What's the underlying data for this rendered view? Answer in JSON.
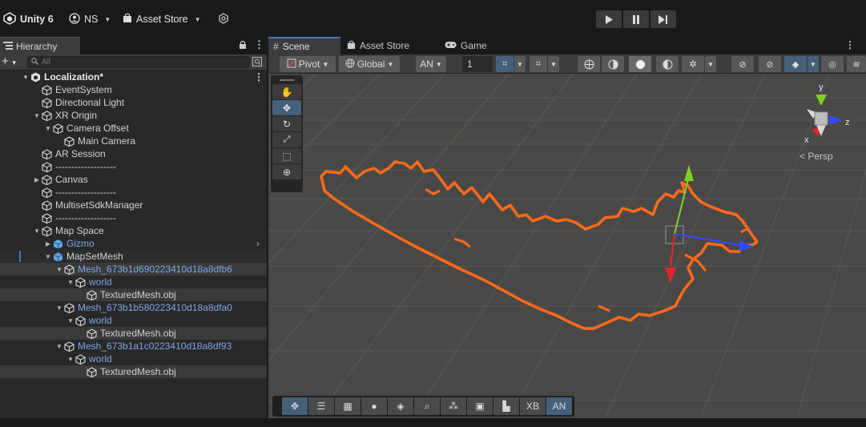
{
  "topbar": {
    "app_title": "Unity 6",
    "account": "NS",
    "asset_store": "Asset Store"
  },
  "hierarchy": {
    "tab_label": "Hierarchy",
    "search_placeholder": "All",
    "scene_name": "Localization*",
    "rows": [
      {
        "label": "EventSystem"
      },
      {
        "label": "Directional Light"
      },
      {
        "label": "XR Origin"
      },
      {
        "label": "Camera Offset"
      },
      {
        "label": "Main Camera"
      },
      {
        "label": "AR Session"
      },
      {
        "label": "-------------------"
      },
      {
        "label": "Canvas"
      },
      {
        "label": "-------------------"
      },
      {
        "label": "MultisetSdkManager"
      },
      {
        "label": "-------------------"
      },
      {
        "label": "Map Space"
      },
      {
        "label": "Gizmo"
      },
      {
        "label": "MapSetMesh"
      },
      {
        "label": "Mesh_673b1d690223410d18a8dfb6"
      },
      {
        "label": "world"
      },
      {
        "label": "TexturedMesh.obj"
      },
      {
        "label": "Mesh_673b1b580223410d18a8dfa0"
      },
      {
        "label": "world"
      },
      {
        "label": "TexturedMesh.obj"
      },
      {
        "label": "Mesh_673b1a1c0223410d18a8df93"
      },
      {
        "label": "world"
      },
      {
        "label": "TexturedMesh.obj"
      }
    ]
  },
  "scene": {
    "tabs": [
      "Scene",
      "Asset Store",
      "Game"
    ],
    "pivot_label": "Pivot",
    "global_label": "Global",
    "an_label": "AN",
    "grid_value": "1",
    "persp_label": "< Persp",
    "gizmo_axes": {
      "x": "x",
      "y": "y",
      "z": "z"
    },
    "bottom_tool_xb": "XB",
    "bottom_tool_an": "AN"
  },
  "colors": {
    "accent_blue": "#3a79bb",
    "mesh_outline": "#ff6a1a",
    "selection_blue": "#7fa7e6"
  }
}
